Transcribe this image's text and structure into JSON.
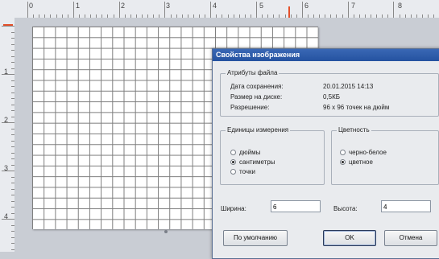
{
  "ruler": {
    "top_numbers": [
      "0",
      "1",
      "2",
      "3",
      "4",
      "5",
      "6",
      "7",
      "8"
    ],
    "left_numbers": [
      "0",
      "1",
      "2",
      "3",
      "4"
    ]
  },
  "dialog": {
    "title": "Свойства изображения",
    "close_glyph": "x",
    "file_attributes": {
      "title": "Атрибуты файла",
      "saved_label": "Дата сохранения:",
      "saved_value": "20.01.2015 14:13",
      "size_label": "Размер на диске:",
      "size_value": "0,5КБ",
      "resolution_label": "Разрешение:",
      "resolution_value": "96 x 96 точек на дюйм"
    },
    "units": {
      "title": "Единицы измерения",
      "options": [
        "дюймы",
        "сантиметры",
        "точки"
      ],
      "selected": "сантиметры"
    },
    "color": {
      "title": "Цветность",
      "options": [
        "черно-белое",
        "цветное"
      ],
      "selected": "цветное"
    },
    "width_label": "Ширина:",
    "width_value": "6",
    "height_label": "Высота:",
    "height_value": "4",
    "default_button": "По умолчанию",
    "ok_button": "OK",
    "cancel_button": "Отмена"
  }
}
